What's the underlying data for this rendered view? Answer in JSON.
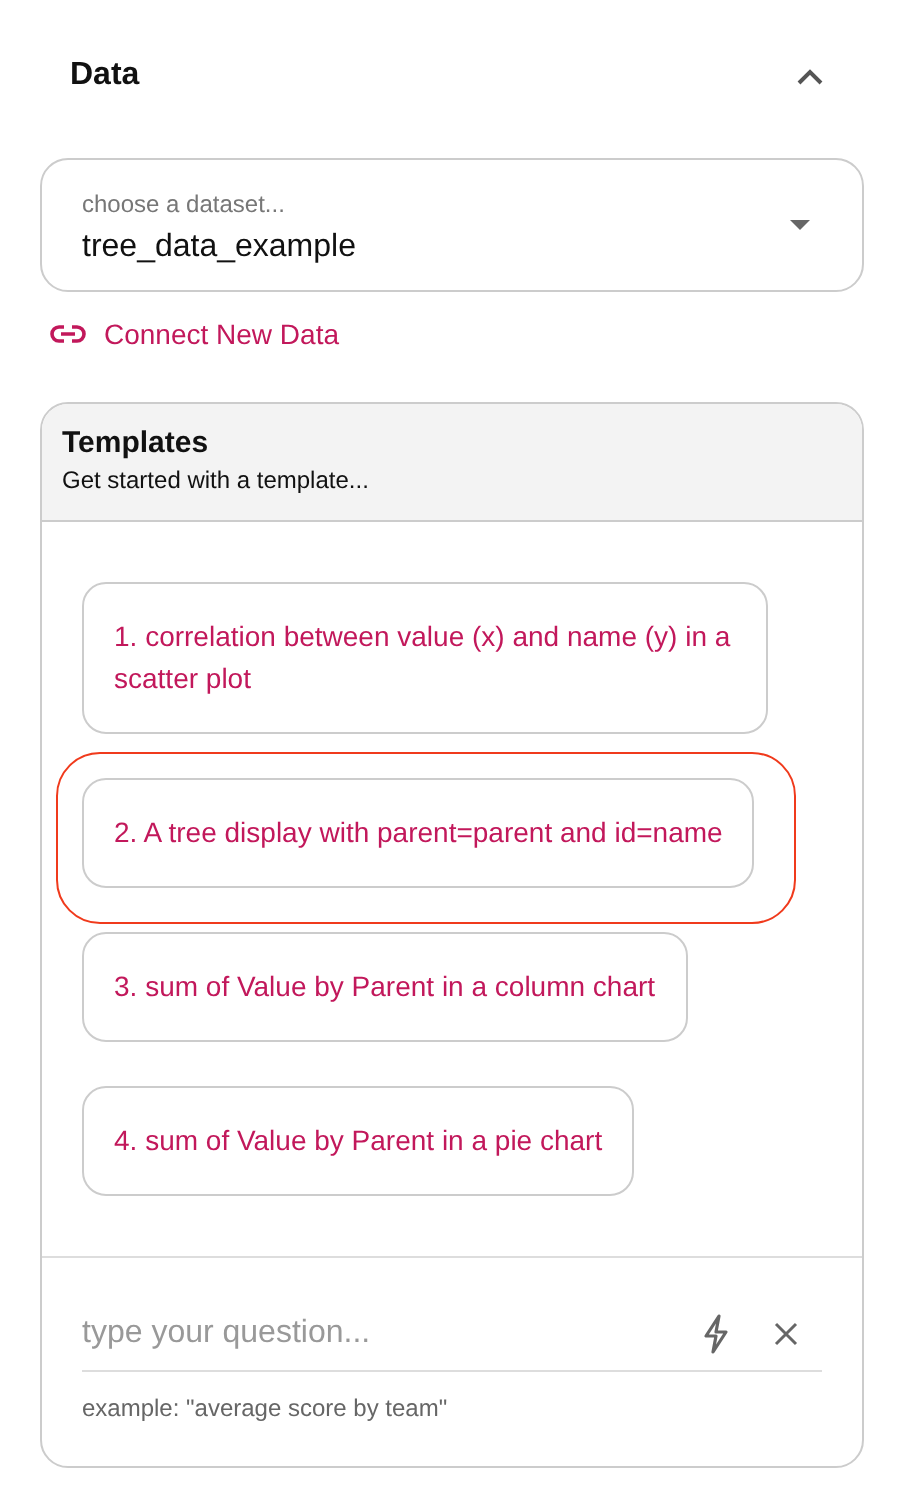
{
  "section": {
    "title": "Data",
    "expanded": true
  },
  "dataset_select": {
    "label": "choose a dataset...",
    "value": "tree_data_example"
  },
  "connect_link": "Connect New Data",
  "templates": {
    "title": "Templates",
    "subtitle": "Get started with a template...",
    "items": [
      {
        "text": "1. correlation between value (x) and name (y) in a scatter plot",
        "highlighted": false
      },
      {
        "text": "2. A tree display with parent=parent and id=name",
        "highlighted": true
      },
      {
        "text": "3. sum of Value by Parent in a column chart",
        "highlighted": false
      },
      {
        "text": "4. sum of Value by Parent in a pie chart",
        "highlighted": false
      }
    ]
  },
  "question": {
    "placeholder": "type your question...",
    "hint": "example: \"average score by team\""
  }
}
